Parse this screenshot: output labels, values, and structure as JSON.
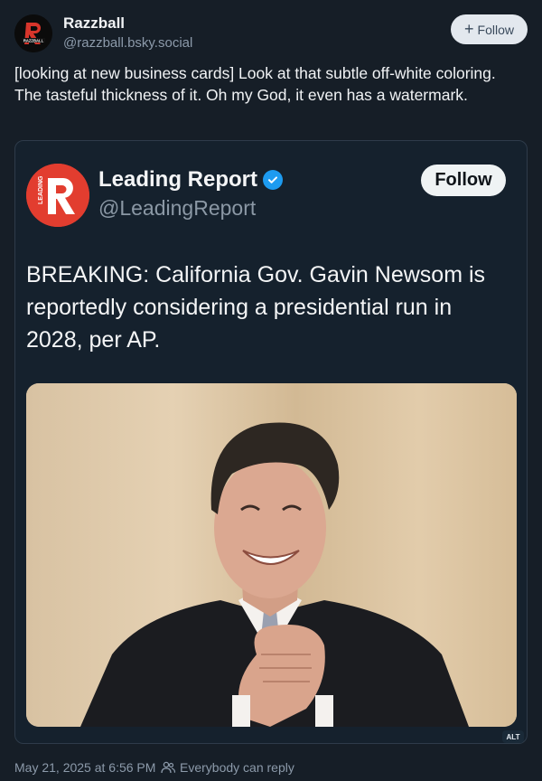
{
  "author": {
    "name": "Razzball",
    "handle": "@razzball.bsky.social",
    "avatar_text": "RAZZBALL"
  },
  "follow_button": {
    "label": "Follow"
  },
  "post": {
    "text": "[looking at new business cards] Look at that subtle off-white coloring. The tasteful thickness of it. Oh my God, it even has a watermark."
  },
  "embed": {
    "account_name": "Leading Report",
    "account_handle": "@LeadingReport",
    "avatar_text": "LEADING",
    "follow_label": "Follow",
    "text": "BREAKING: California Gov. Gavin Newsom is reportedly considering a presidential run in 2028, per AP.",
    "alt_badge": "ALT"
  },
  "footer": {
    "timestamp": "May 21, 2025 at 6:56 PM",
    "reply_setting": "Everybody can reply"
  },
  "colors": {
    "background": "#161e27",
    "accent_red": "#e23d2f",
    "verified_blue": "#1d9bf0"
  }
}
